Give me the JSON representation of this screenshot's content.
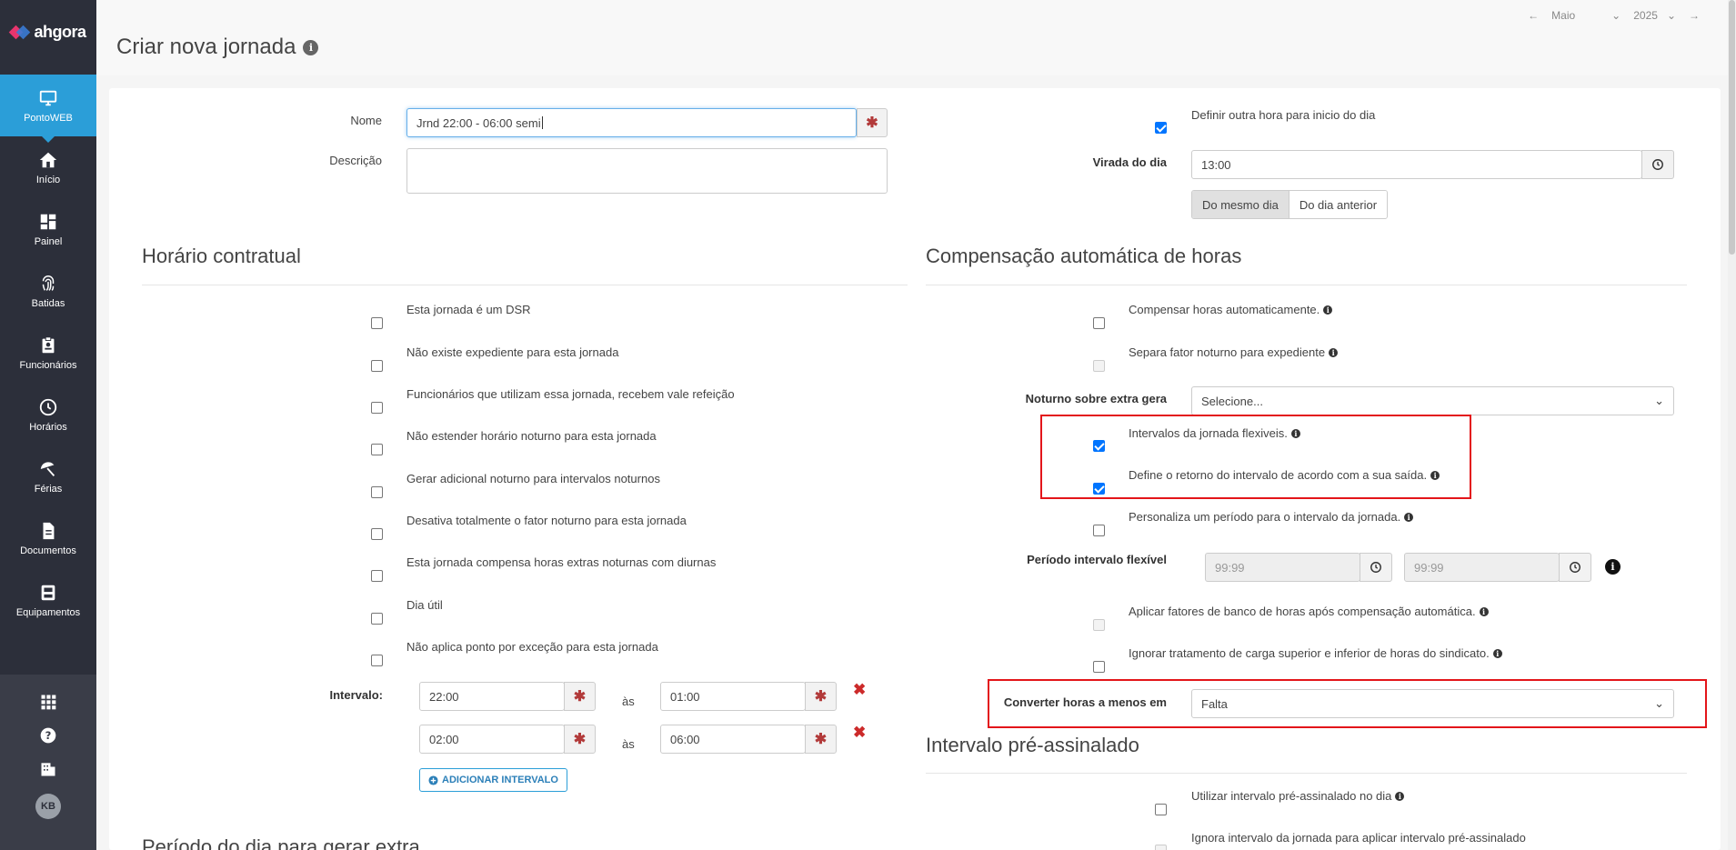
{
  "sidebar": {
    "logo": "ahgora",
    "items": [
      {
        "label": "PontoWEB",
        "icon": "monitor-icon"
      },
      {
        "label": "Início",
        "icon": "home-icon"
      },
      {
        "label": "Painel",
        "icon": "dashboard-icon"
      },
      {
        "label": "Batidas",
        "icon": "fingerprint-icon"
      },
      {
        "label": "Funcionários",
        "icon": "badge-icon"
      },
      {
        "label": "Horários",
        "icon": "clock-icon"
      },
      {
        "label": "Férias",
        "icon": "umbrella-icon"
      },
      {
        "label": "Documentos",
        "icon": "document-icon"
      },
      {
        "label": "Equipamentos",
        "icon": "device-icon"
      }
    ],
    "avatar": "KB"
  },
  "header": {
    "title": "Criar nova jornada",
    "month": "Maio",
    "year": "2025"
  },
  "form": {
    "nome_label": "Nome",
    "nome_value": "Jrnd 22:00 - 06:00 semi",
    "descricao_label": "Descrição",
    "descricao_value": "",
    "definir_hora_label": "Definir outra hora para inicio do dia",
    "virada_label": "Virada do dia",
    "virada_value": "13:00",
    "seg_mesmo": "Do mesmo dia",
    "seg_anterior": "Do dia anterior"
  },
  "contratual": {
    "title": "Horário contratual",
    "options": [
      "Esta jornada é um DSR",
      "Não existe expediente para esta jornada",
      "Funcionários que utilizam essa jornada, recebem vale refeição",
      "Não estender horário noturno para esta jornada",
      "Gerar adicional noturno para intervalos noturnos",
      "Desativa totalmente o fator noturno para esta jornada",
      "Esta jornada compensa horas extras noturnas com diurnas",
      "Dia útil",
      "Não aplica ponto por exceção para esta jornada"
    ],
    "intervalo_label": "Intervalo:",
    "sep": "às",
    "intervals": [
      {
        "start": "22:00",
        "end": "01:00"
      },
      {
        "start": "02:00",
        "end": "06:00"
      }
    ],
    "add_button": "ADICIONAR INTERVALO",
    "next_title": "Período do dia para gerar extra"
  },
  "compensacao": {
    "title": "Compensação automática de horas",
    "opt1": "Compensar horas automaticamente.",
    "opt2": "Separa fator noturno para expediente",
    "noturno_label": "Noturno sobre extra gera",
    "noturno_value": "Selecione...",
    "opt3": "Intervalos da jornada flexiveis.",
    "opt4": "Define o retorno do intervalo de acordo com a sua saída.",
    "opt5": "Personaliza um período para o intervalo da jornada.",
    "periodo_label": "Período intervalo flexível",
    "periodo_start": "99:99",
    "periodo_end": "99:99",
    "opt6": "Aplicar fatores de banco de horas após compensação automática.",
    "opt7": "Ignorar tratamento de carga superior e inferior de horas do sindicato.",
    "converter_label": "Converter horas a menos em",
    "converter_value": "Falta"
  },
  "preassinalado": {
    "title": "Intervalo pré-assinalado",
    "opt1": "Utilizar intervalo pré-assinalado no dia",
    "opt2": "Ignora intervalo da jornada para aplicar intervalo pré-assinalado"
  },
  "colors": {
    "accent": "#2b9ed8",
    "sidebar": "#2c2f3a",
    "highlight": "#e3151a",
    "required": "#b23a3a"
  }
}
